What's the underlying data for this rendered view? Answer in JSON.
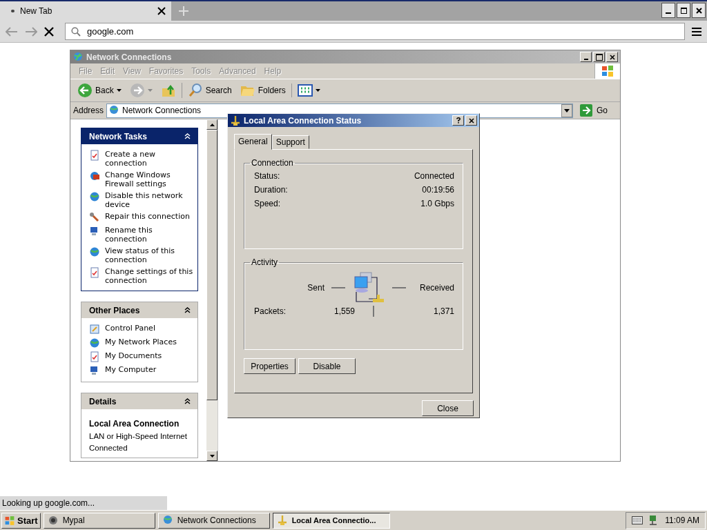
{
  "browser": {
    "tab": {
      "title": "New Tab"
    },
    "address": "google.com",
    "status": "Looking up google.com..."
  },
  "explorer": {
    "title": "Network Connections",
    "menu": [
      "File",
      "Edit",
      "View",
      "Favorites",
      "Tools",
      "Advanced",
      "Help"
    ],
    "toolbar": [
      {
        "kind": "back",
        "label": "Back"
      },
      {
        "kind": "forward"
      },
      {
        "kind": "up"
      },
      {
        "kind": "search",
        "label": "Search"
      },
      {
        "kind": "folders",
        "label": "Folders"
      },
      {
        "kind": "views"
      }
    ],
    "address": {
      "label": "Address",
      "value": "Network Connections",
      "go": "Go"
    },
    "panels": [
      {
        "kind": "tasks",
        "title": "Network Tasks",
        "items": [
          "Create a new connection",
          "Change Windows Firewall settings",
          "Disable this network device",
          "Repair this connection",
          "Rename this connection",
          "View status of this connection",
          "Change settings of this connection"
        ]
      },
      {
        "kind": "places",
        "title": "Other Places",
        "items": [
          "Control Panel",
          "My Network Places",
          "My Documents",
          "My Computer"
        ]
      },
      {
        "kind": "details",
        "title": "Details",
        "name": "Local Area Connection",
        "lines": [
          "LAN or High-Speed Internet",
          "Connected"
        ]
      }
    ]
  },
  "dialog": {
    "title": "Local Area Connection Status",
    "tabs": [
      {
        "label": "General",
        "selected": true
      },
      {
        "label": "Support",
        "selected": false
      }
    ],
    "connection": {
      "title": "Connection",
      "rows": [
        {
          "label": "Status:",
          "value": "Connected"
        },
        {
          "label": "Duration:",
          "value": "00:19:56"
        },
        {
          "label": "Speed:",
          "value": "1.0 Gbps"
        }
      ]
    },
    "activity": {
      "title": "Activity",
      "sent": "Sent",
      "received": "Received",
      "packets_label": "Packets:",
      "sent_value": "1,559",
      "received_value": "1,371"
    },
    "buttons": [
      "Properties",
      "Disable"
    ],
    "close": "Close"
  },
  "taskbar": {
    "start": "Start",
    "tasks": [
      {
        "label": "Mypal",
        "selected": false
      },
      {
        "label": "Network Connections",
        "selected": false
      },
      {
        "label": "Local Area Connectio...",
        "selected": true
      }
    ],
    "clock": "11:09 AM"
  }
}
